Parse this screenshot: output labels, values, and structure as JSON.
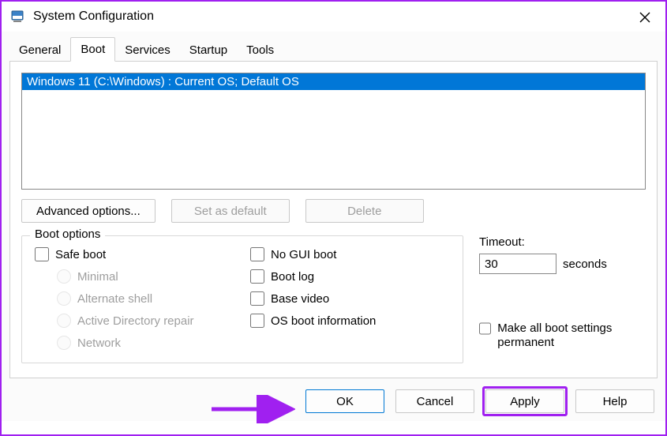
{
  "window": {
    "title": "System Configuration"
  },
  "tabs": {
    "general": "General",
    "boot": "Boot",
    "services": "Services",
    "startup": "Startup",
    "tools": "Tools",
    "active": "boot"
  },
  "os_list": {
    "entry": "Windows 11 (C:\\Windows) : Current OS; Default OS"
  },
  "buttons": {
    "advanced": "Advanced options...",
    "set_default": "Set as default",
    "delete": "Delete"
  },
  "boot_options": {
    "legend": "Boot options",
    "safe_boot": "Safe boot",
    "minimal": "Minimal",
    "alternate_shell": "Alternate shell",
    "ad_repair": "Active Directory repair",
    "network": "Network",
    "no_gui": "No GUI boot",
    "boot_log": "Boot log",
    "base_video": "Base video",
    "os_info": "OS boot information"
  },
  "timeout": {
    "label": "Timeout:",
    "value": "30",
    "unit": "seconds"
  },
  "make_permanent": {
    "line": "Make all boot settings permanent"
  },
  "footer": {
    "ok": "OK",
    "cancel": "Cancel",
    "apply": "Apply",
    "help": "Help"
  }
}
